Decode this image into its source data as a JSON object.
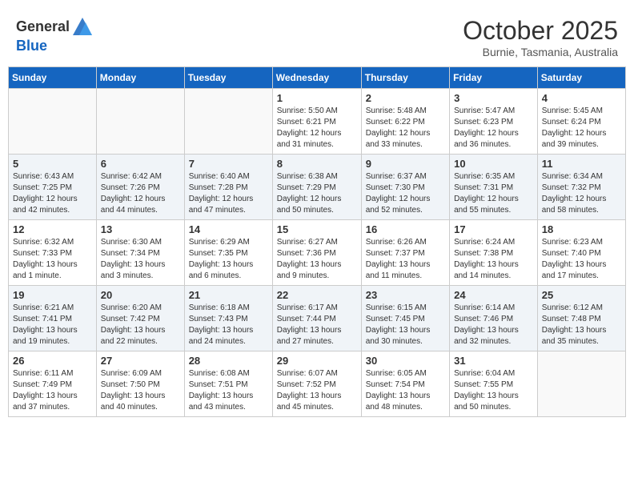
{
  "header": {
    "logo_general": "General",
    "logo_blue": "Blue",
    "month": "October 2025",
    "location": "Burnie, Tasmania, Australia"
  },
  "weekdays": [
    "Sunday",
    "Monday",
    "Tuesday",
    "Wednesday",
    "Thursday",
    "Friday",
    "Saturday"
  ],
  "weeks": [
    [
      {
        "day": "",
        "info": ""
      },
      {
        "day": "",
        "info": ""
      },
      {
        "day": "",
        "info": ""
      },
      {
        "day": "1",
        "info": "Sunrise: 5:50 AM\nSunset: 6:21 PM\nDaylight: 12 hours\nand 31 minutes."
      },
      {
        "day": "2",
        "info": "Sunrise: 5:48 AM\nSunset: 6:22 PM\nDaylight: 12 hours\nand 33 minutes."
      },
      {
        "day": "3",
        "info": "Sunrise: 5:47 AM\nSunset: 6:23 PM\nDaylight: 12 hours\nand 36 minutes."
      },
      {
        "day": "4",
        "info": "Sunrise: 5:45 AM\nSunset: 6:24 PM\nDaylight: 12 hours\nand 39 minutes."
      }
    ],
    [
      {
        "day": "5",
        "info": "Sunrise: 6:43 AM\nSunset: 7:25 PM\nDaylight: 12 hours\nand 42 minutes."
      },
      {
        "day": "6",
        "info": "Sunrise: 6:42 AM\nSunset: 7:26 PM\nDaylight: 12 hours\nand 44 minutes."
      },
      {
        "day": "7",
        "info": "Sunrise: 6:40 AM\nSunset: 7:28 PM\nDaylight: 12 hours\nand 47 minutes."
      },
      {
        "day": "8",
        "info": "Sunrise: 6:38 AM\nSunset: 7:29 PM\nDaylight: 12 hours\nand 50 minutes."
      },
      {
        "day": "9",
        "info": "Sunrise: 6:37 AM\nSunset: 7:30 PM\nDaylight: 12 hours\nand 52 minutes."
      },
      {
        "day": "10",
        "info": "Sunrise: 6:35 AM\nSunset: 7:31 PM\nDaylight: 12 hours\nand 55 minutes."
      },
      {
        "day": "11",
        "info": "Sunrise: 6:34 AM\nSunset: 7:32 PM\nDaylight: 12 hours\nand 58 minutes."
      }
    ],
    [
      {
        "day": "12",
        "info": "Sunrise: 6:32 AM\nSunset: 7:33 PM\nDaylight: 13 hours\nand 1 minute."
      },
      {
        "day": "13",
        "info": "Sunrise: 6:30 AM\nSunset: 7:34 PM\nDaylight: 13 hours\nand 3 minutes."
      },
      {
        "day": "14",
        "info": "Sunrise: 6:29 AM\nSunset: 7:35 PM\nDaylight: 13 hours\nand 6 minutes."
      },
      {
        "day": "15",
        "info": "Sunrise: 6:27 AM\nSunset: 7:36 PM\nDaylight: 13 hours\nand 9 minutes."
      },
      {
        "day": "16",
        "info": "Sunrise: 6:26 AM\nSunset: 7:37 PM\nDaylight: 13 hours\nand 11 minutes."
      },
      {
        "day": "17",
        "info": "Sunrise: 6:24 AM\nSunset: 7:38 PM\nDaylight: 13 hours\nand 14 minutes."
      },
      {
        "day": "18",
        "info": "Sunrise: 6:23 AM\nSunset: 7:40 PM\nDaylight: 13 hours\nand 17 minutes."
      }
    ],
    [
      {
        "day": "19",
        "info": "Sunrise: 6:21 AM\nSunset: 7:41 PM\nDaylight: 13 hours\nand 19 minutes."
      },
      {
        "day": "20",
        "info": "Sunrise: 6:20 AM\nSunset: 7:42 PM\nDaylight: 13 hours\nand 22 minutes."
      },
      {
        "day": "21",
        "info": "Sunrise: 6:18 AM\nSunset: 7:43 PM\nDaylight: 13 hours\nand 24 minutes."
      },
      {
        "day": "22",
        "info": "Sunrise: 6:17 AM\nSunset: 7:44 PM\nDaylight: 13 hours\nand 27 minutes."
      },
      {
        "day": "23",
        "info": "Sunrise: 6:15 AM\nSunset: 7:45 PM\nDaylight: 13 hours\nand 30 minutes."
      },
      {
        "day": "24",
        "info": "Sunrise: 6:14 AM\nSunset: 7:46 PM\nDaylight: 13 hours\nand 32 minutes."
      },
      {
        "day": "25",
        "info": "Sunrise: 6:12 AM\nSunset: 7:48 PM\nDaylight: 13 hours\nand 35 minutes."
      }
    ],
    [
      {
        "day": "26",
        "info": "Sunrise: 6:11 AM\nSunset: 7:49 PM\nDaylight: 13 hours\nand 37 minutes."
      },
      {
        "day": "27",
        "info": "Sunrise: 6:09 AM\nSunset: 7:50 PM\nDaylight: 13 hours\nand 40 minutes."
      },
      {
        "day": "28",
        "info": "Sunrise: 6:08 AM\nSunset: 7:51 PM\nDaylight: 13 hours\nand 43 minutes."
      },
      {
        "day": "29",
        "info": "Sunrise: 6:07 AM\nSunset: 7:52 PM\nDaylight: 13 hours\nand 45 minutes."
      },
      {
        "day": "30",
        "info": "Sunrise: 6:05 AM\nSunset: 7:54 PM\nDaylight: 13 hours\nand 48 minutes."
      },
      {
        "day": "31",
        "info": "Sunrise: 6:04 AM\nSunset: 7:55 PM\nDaylight: 13 hours\nand 50 minutes."
      },
      {
        "day": "",
        "info": ""
      }
    ]
  ]
}
